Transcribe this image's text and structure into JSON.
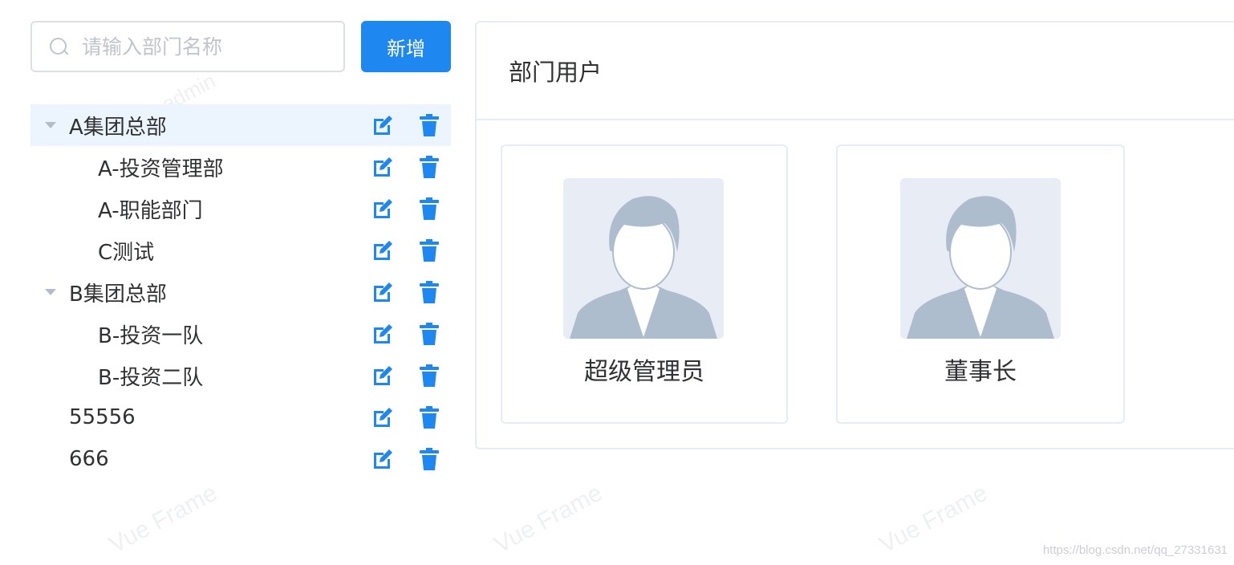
{
  "watermark": {
    "text": "Vue Frame",
    "fragment": "admin"
  },
  "search": {
    "placeholder": "请输入部门名称",
    "value": ""
  },
  "toolbar": {
    "add_label": "新增"
  },
  "colors": {
    "primary": "#1e88f0",
    "border": "#dcdfe6",
    "selected_bg": "#ecf4fd"
  },
  "tree": [
    {
      "label": "A集团总部",
      "level": 1,
      "expanded": true,
      "selected": true
    },
    {
      "label": "A-投资管理部",
      "level": 2
    },
    {
      "label": "A-职能部门",
      "level": 2
    },
    {
      "label": "C测试",
      "level": 2
    },
    {
      "label": "B集团总部",
      "level": 1,
      "expanded": true
    },
    {
      "label": "B-投资一队",
      "level": 2
    },
    {
      "label": "B-投资二队",
      "level": 2
    },
    {
      "label": "55556",
      "level": 1
    },
    {
      "label": "666",
      "level": 1
    }
  ],
  "panel": {
    "title": "部门用户",
    "users": [
      {
        "name": "超级管理员",
        "avatar": "default-avatar-icon"
      },
      {
        "name": "董事长",
        "avatar": "default-avatar-icon"
      }
    ]
  },
  "footer": {
    "url": "https://blog.csdn.net/qq_27331631"
  }
}
